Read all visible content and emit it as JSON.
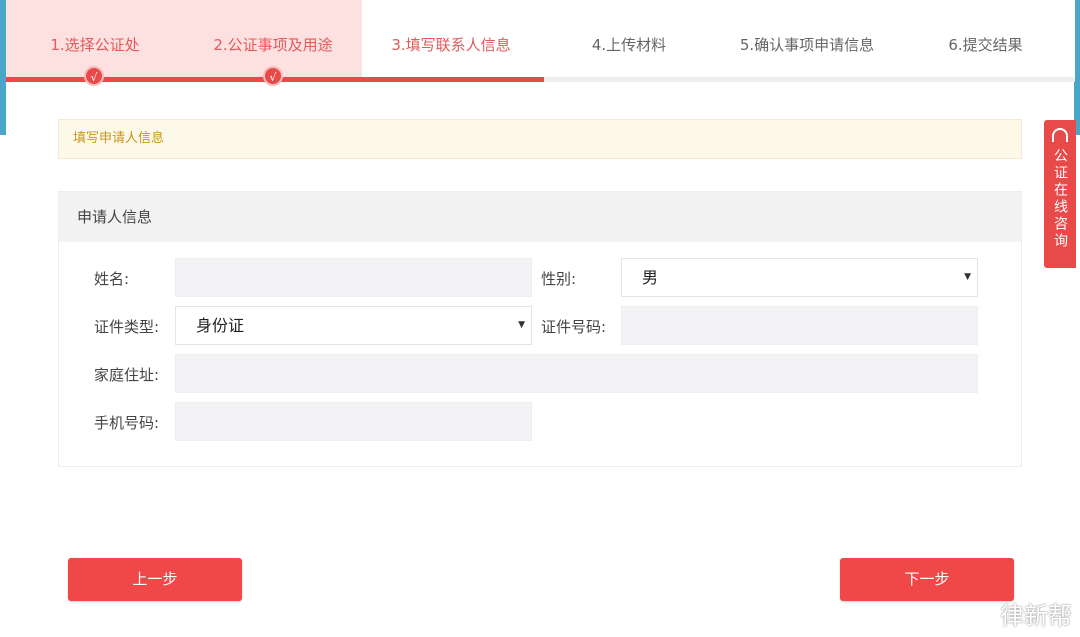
{
  "wizard": {
    "steps": [
      {
        "label": "1.选择公证处",
        "state": "done"
      },
      {
        "label": "2.公证事项及用途",
        "state": "done"
      },
      {
        "label": "3.填写联系人信息",
        "state": "active"
      },
      {
        "label": "4.上传材料",
        "state": "todo"
      },
      {
        "label": "5.确认事项申请信息",
        "state": "todo"
      },
      {
        "label": "6.提交结果",
        "state": "todo"
      }
    ],
    "check_mark": "√"
  },
  "notice": "填写申请人信息",
  "panel": {
    "title": "申请人信息",
    "fields": {
      "name": {
        "label": "姓名:",
        "value": ""
      },
      "gender": {
        "label": "性别:",
        "value": "男"
      },
      "id_type": {
        "label": "证件类型:",
        "value": "身份证"
      },
      "id_number": {
        "label": "证件号码:",
        "value": ""
      },
      "address": {
        "label": "家庭住址:",
        "value": ""
      },
      "phone": {
        "label": "手机号码:",
        "value": ""
      }
    }
  },
  "buttons": {
    "prev": "上一步",
    "next": "下一步"
  },
  "side_tab": {
    "label": "公证在线咨询"
  },
  "watermark": "律新帮",
  "colors": {
    "accent": "#e84a4a",
    "done_bg": "#fde0e0",
    "notice_text": "#c8961e"
  }
}
